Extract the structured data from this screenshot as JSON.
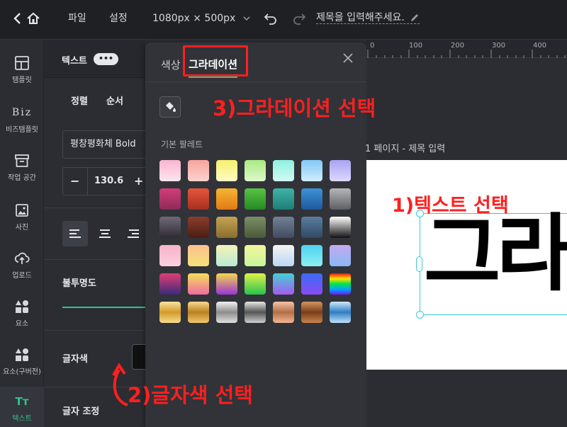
{
  "topbar": {
    "file": "파일",
    "settings": "설정",
    "size": "1080px × 500px",
    "title_placeholder": "제목을 입력해주세요."
  },
  "rail": [
    {
      "label": "템플릿",
      "icon": "layout-icon"
    },
    {
      "label": "비즈템플릿",
      "icon": "biz-icon",
      "glyph": "Biz"
    },
    {
      "label": "작업 공간",
      "icon": "archive-icon"
    },
    {
      "label": "사진",
      "icon": "image-icon"
    },
    {
      "label": "업로드",
      "icon": "upload-icon"
    },
    {
      "label": "요소",
      "icon": "shapes-icon"
    },
    {
      "label": "요소(구버전)",
      "icon": "shapes-old-icon"
    },
    {
      "label": "텍스트",
      "icon": "text-icon",
      "glyph": "Tт"
    }
  ],
  "text_panel": {
    "title": "텍스트",
    "more": "•••",
    "align_label": "정렬",
    "order_label": "순서",
    "font": "평창평화체 Bold",
    "font_size": "130.6",
    "opacity_label": "불투명도",
    "text_color_label": "글자색",
    "text_adjust_label": "글자 조정"
  },
  "color_popover": {
    "tab_color": "색상",
    "tab_gradient": "그라데이션",
    "palette_label": "기본 팔레트",
    "swatches": [
      [
        "linear-gradient(180deg,#f9b3cf,#fde6ef)",
        "linear-gradient(180deg,#f7a39c,#fdd3cf)",
        "linear-gradient(180deg,#f8f06e,#fdfbc5)",
        "linear-gradient(180deg,#a9ea82,#ddf9c8)",
        "linear-gradient(180deg,#8ff0e0,#d2fbf3)",
        "linear-gradient(180deg,#84c8f6,#d0ecfd)",
        "linear-gradient(180deg,#a9a3f3,#dcd8fd)"
      ],
      [
        "linear-gradient(180deg,#d43d7a,#8d2a58)",
        "linear-gradient(180deg,#e7543c,#a5301f)",
        "linear-gradient(180deg,#f7b531,#e07a16)",
        "linear-gradient(180deg,#58c246,#268a23)",
        "linear-gradient(180deg,#3fb4a7,#1f7d77)",
        "linear-gradient(180deg,#3d92d7,#1d5a9c)",
        "linear-gradient(180deg,#b6b6b9,#5e5f63)"
      ],
      [
        "linear-gradient(180deg,#6f6978,#2f2b33)",
        "linear-gradient(180deg,#8b3d2c,#4a1d14)",
        "linear-gradient(180deg,#c5a353,#8a6d2e)",
        "linear-gradient(180deg,#7b8f67,#4a5a3b)",
        "linear-gradient(180deg,#738096,#414c5f)",
        "linear-gradient(180deg,#5b7c9e,#2f4a66)",
        "linear-gradient(180deg,#ffffff,#111111)"
      ],
      [
        "linear-gradient(180deg,#f8b1c8,#fbd1de)",
        "linear-gradient(180deg,#fbc18f,#f6e27a)",
        "linear-gradient(180deg,#f6f2b8,#b8ead3)",
        "linear-gradient(180deg,#f3f49b,#c6f79b)",
        "linear-gradient(180deg,#f3f3f3,#bdd7f5)",
        "linear-gradient(180deg,#4ed1f2,#8df0ef)",
        "linear-gradient(180deg,#c5a9f0,#88b8f4)"
      ],
      [
        "linear-gradient(180deg,#e03e73,#3c2a7c)",
        "linear-gradient(180deg,#f4e05a,#f06aa2)",
        "linear-gradient(180deg,#f5d64a,#9a34d6)",
        "linear-gradient(180deg,#dff14b,#28c34d)",
        "linear-gradient(180deg,#45d0d5,#a45bf0)",
        "linear-gradient(180deg,#3a6cf4,#8a4af4)",
        "linear-gradient(180deg,#ff1010,#ffe600,#00e34b,#00a6ff,#6a1bff)"
      ],
      [
        "linear-gradient(180deg,#f9e3a0,#d39a2a,#f7dd8f)",
        "linear-gradient(180deg,#f9d98e,#b9821f,#f3c86e)",
        "linear-gradient(180deg,#f2f2f2,#8d8d8d,#e0e0e0)",
        "linear-gradient(180deg,#e6e6e6,#555555,#cfcfcf)",
        "linear-gradient(180deg,#f6c4a5,#b46e46,#f2b691)",
        "linear-gradient(180deg,#d49564,#7a3d19,#c98450)",
        "linear-gradient(180deg,#cfe8fb,#2d7ec4,#bfe1fb)"
      ]
    ]
  },
  "canvas": {
    "page_label": "1 페이지 - 제목 입력",
    "ruler_ticks": [
      "0",
      "100",
      "200",
      "300",
      "400"
    ],
    "sample_text": "그라"
  },
  "annotations": {
    "step1": "1)텍스트 선택",
    "step2": "2)글자색 선택",
    "step3": "3)그라데이션 선택"
  },
  "colors": {
    "accent": "#2fc48d",
    "annotation": "#ff1f1f",
    "selection": "#38c8df"
  }
}
